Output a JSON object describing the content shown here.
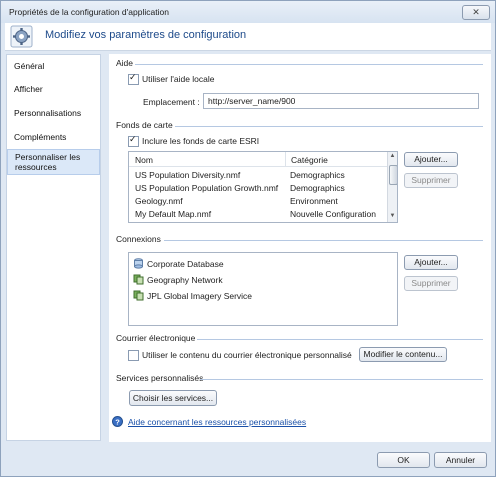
{
  "window": {
    "title": "Propriétés de la configuration d'application"
  },
  "header": {
    "title": "Modifiez vos paramètres de configuration"
  },
  "nav": {
    "items": [
      "Général",
      "Afficher",
      "Personnalisations",
      "Compléments",
      "Personnaliser les ressources"
    ],
    "selected_index": 4
  },
  "aide": {
    "title": "Aide",
    "use_local_help_label": "Utiliser l'aide locale",
    "use_local_help_checked": true,
    "location_label": "Emplacement :",
    "location_value": "http://server_name/900"
  },
  "basemaps": {
    "title": "Fonds de carte",
    "include_esri_label": "Inclure les fonds de carte ESRI",
    "include_esri_checked": true,
    "columns": [
      "Nom",
      "Catégorie"
    ],
    "rows": [
      [
        "US Population Diversity.nmf",
        "Demographics"
      ],
      [
        "US Population Population Growth.nmf",
        "Demographics"
      ],
      [
        "Geology.nmf",
        "Environment"
      ],
      [
        "My Default Map.nmf",
        "Nouvelle Configuration"
      ]
    ],
    "add_label": "Ajouter...",
    "remove_label": "Supprimer"
  },
  "connections": {
    "title": "Connexions",
    "items": [
      {
        "label": "Corporate Database",
        "icon": "database-icon"
      },
      {
        "label": "Geography Network",
        "icon": "map-service-icon"
      },
      {
        "label": "JPL Global Imagery Service",
        "icon": "map-service-icon"
      }
    ],
    "add_label": "Ajouter...",
    "remove_label": "Supprimer"
  },
  "email": {
    "title": "Courrier électronique",
    "custom_label": "Utiliser le contenu du courrier électronique personnalisé",
    "custom_checked": false,
    "modify_label": "Modifier le contenu..."
  },
  "services": {
    "title": "Services personnalisés",
    "choose_label": "Choisir les services..."
  },
  "help_link": "Aide concernant les ressources personnalisées",
  "footer": {
    "ok_label": "OK",
    "cancel_label": "Annuler"
  }
}
